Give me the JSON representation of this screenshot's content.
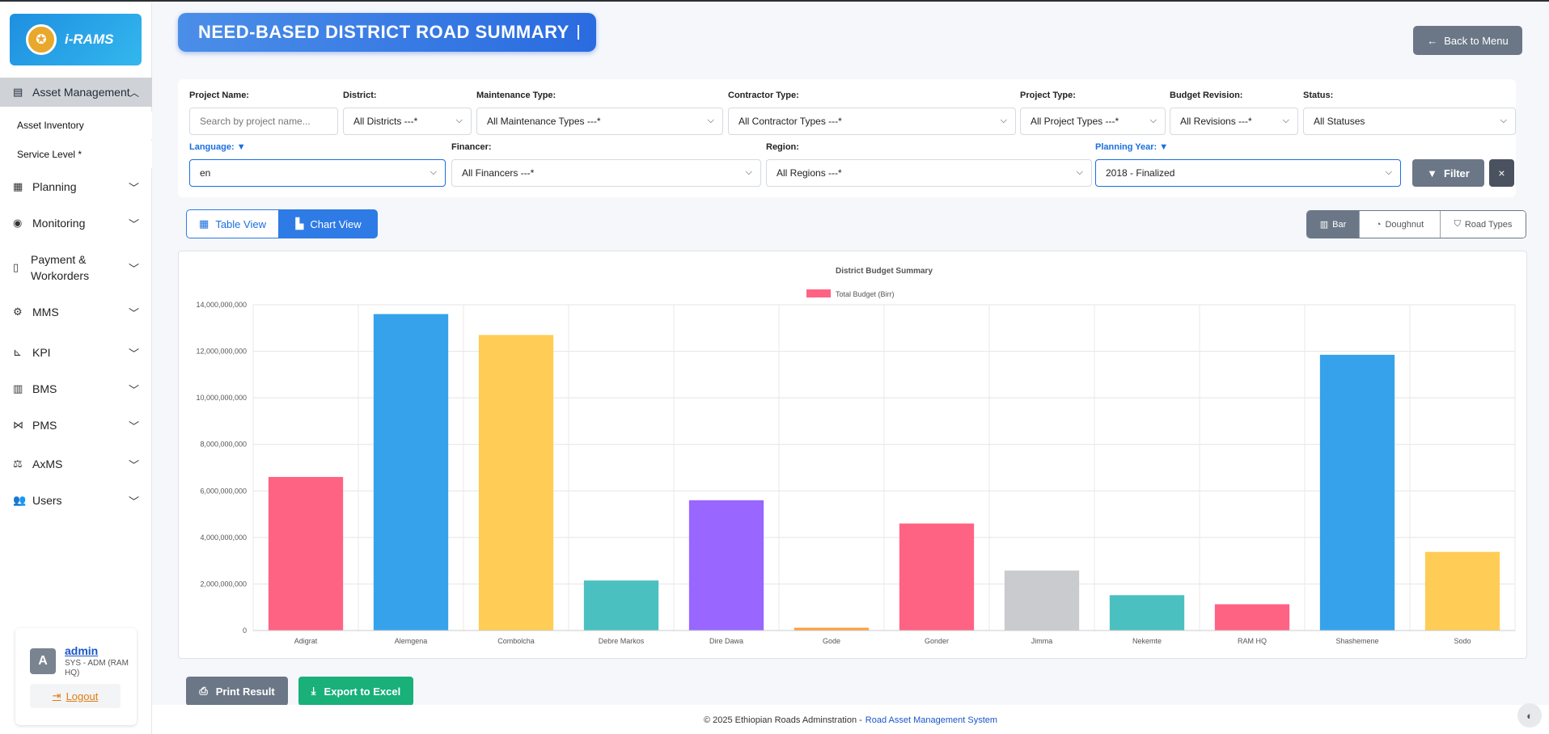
{
  "app": {
    "logo_text": "i-RAMS",
    "logo_icon": "ethiopian-roads-emblem-icon"
  },
  "sidebar": {
    "section": {
      "label": "Asset Management",
      "icon": "road-icon"
    },
    "subitems": [
      "Asset Inventory",
      "Service Level *"
    ],
    "items": [
      {
        "label": "Planning",
        "icon": "calendar-icon"
      },
      {
        "label": "Monitoring",
        "icon": "eye-icon"
      },
      {
        "label": "Payment &\nWorkorders",
        "icon": "invoice-icon"
      },
      {
        "label": "MMS",
        "icon": "gears-icon"
      },
      {
        "label": "KPI",
        "icon": "chart-line-icon"
      },
      {
        "label": "BMS",
        "icon": "building-icon"
      },
      {
        "label": "PMS",
        "icon": "network-icon"
      },
      {
        "label": "AxMS",
        "icon": "scale-icon"
      },
      {
        "label": "Users",
        "icon": "users-icon"
      }
    ]
  },
  "user": {
    "initial": "A",
    "name": "admin",
    "role": "SYS - ADM (RAM HQ)",
    "logout": "Logout"
  },
  "header": {
    "title": "NEED-BASED DISTRICT ROAD SUMMARY",
    "back_button": "Back to Menu"
  },
  "filters": {
    "project_name": {
      "label": "Project Name:",
      "placeholder": "Search by project name..."
    },
    "district": {
      "label": "District:",
      "value": "All Districts ---*"
    },
    "maintenance_type": {
      "label": "Maintenance Type:",
      "value": "All Maintenance Types ---*"
    },
    "contractor_type": {
      "label": "Contractor Type:",
      "value": "All Contractor Types ---*"
    },
    "project_type": {
      "label": "Project Type:",
      "value": "All Project Types ---*"
    },
    "budget_revision": {
      "label": "Budget Revision:",
      "value": "All Revisions ---*"
    },
    "status": {
      "label": "Status:",
      "value": "All Statuses"
    },
    "language": {
      "label": "Language:",
      "value": "en"
    },
    "financer": {
      "label": "Financer:",
      "value": "All Financers ---*"
    },
    "region": {
      "label": "Region:",
      "value": "All Regions ---*"
    },
    "planning_year": {
      "label": "Planning Year:",
      "value": "2018 - Finalized"
    },
    "filter_button": "Filter",
    "clear_button": "×"
  },
  "views": {
    "table": "Table View",
    "chart": "Chart View"
  },
  "chart_types": {
    "bar": "Bar",
    "doughnut": "Doughnut",
    "road_types": "Road Types"
  },
  "colors": {
    "accent": "#2f7be6",
    "pink": "#ff6384",
    "blue": "#36a2eb",
    "yellow": "#ffcd56",
    "teal": "#4bc0c0",
    "purple": "#9966ff",
    "orange": "#ff9f40",
    "grey": "#c9cbcf"
  },
  "chart_data": {
    "type": "bar",
    "title": "District Budget Summary",
    "legend": "Total Budget (Birr)",
    "categories": [
      "Adigrat",
      "Alemgena",
      "Combolcha",
      "Debre Markos",
      "Dire Dawa",
      "Gode",
      "Gonder",
      "Jimma",
      "Nekemte",
      "RAM HQ",
      "Shashemene",
      "Sodo"
    ],
    "values": [
      6600000000,
      13600000000,
      12700000000,
      2150000000,
      5600000000,
      120000000,
      4600000000,
      2580000000,
      1520000000,
      1130000000,
      11850000000,
      3380000000
    ],
    "bar_colors": [
      "#ff6384",
      "#36a2eb",
      "#ffcd56",
      "#4bc0c0",
      "#9966ff",
      "#ff9f40",
      "#ff6384",
      "#c9cbcf",
      "#4bc0c0",
      "#ff6384",
      "#36a2eb",
      "#ffcd56"
    ],
    "yticks": [
      "0",
      "2,000,000,000",
      "4,000,000,000",
      "6,000,000,000",
      "8,000,000,000",
      "10,000,000,000",
      "12,000,000,000",
      "14,000,000,000"
    ],
    "ylim": [
      0,
      14000000000
    ],
    "grid": true,
    "legend_position": "top"
  },
  "actions": {
    "print": "Print Result",
    "export": "Export to Excel"
  },
  "footer": {
    "text": "© 2025 Ethiopian Roads Adminstration -",
    "link": "Road Asset Management System"
  }
}
